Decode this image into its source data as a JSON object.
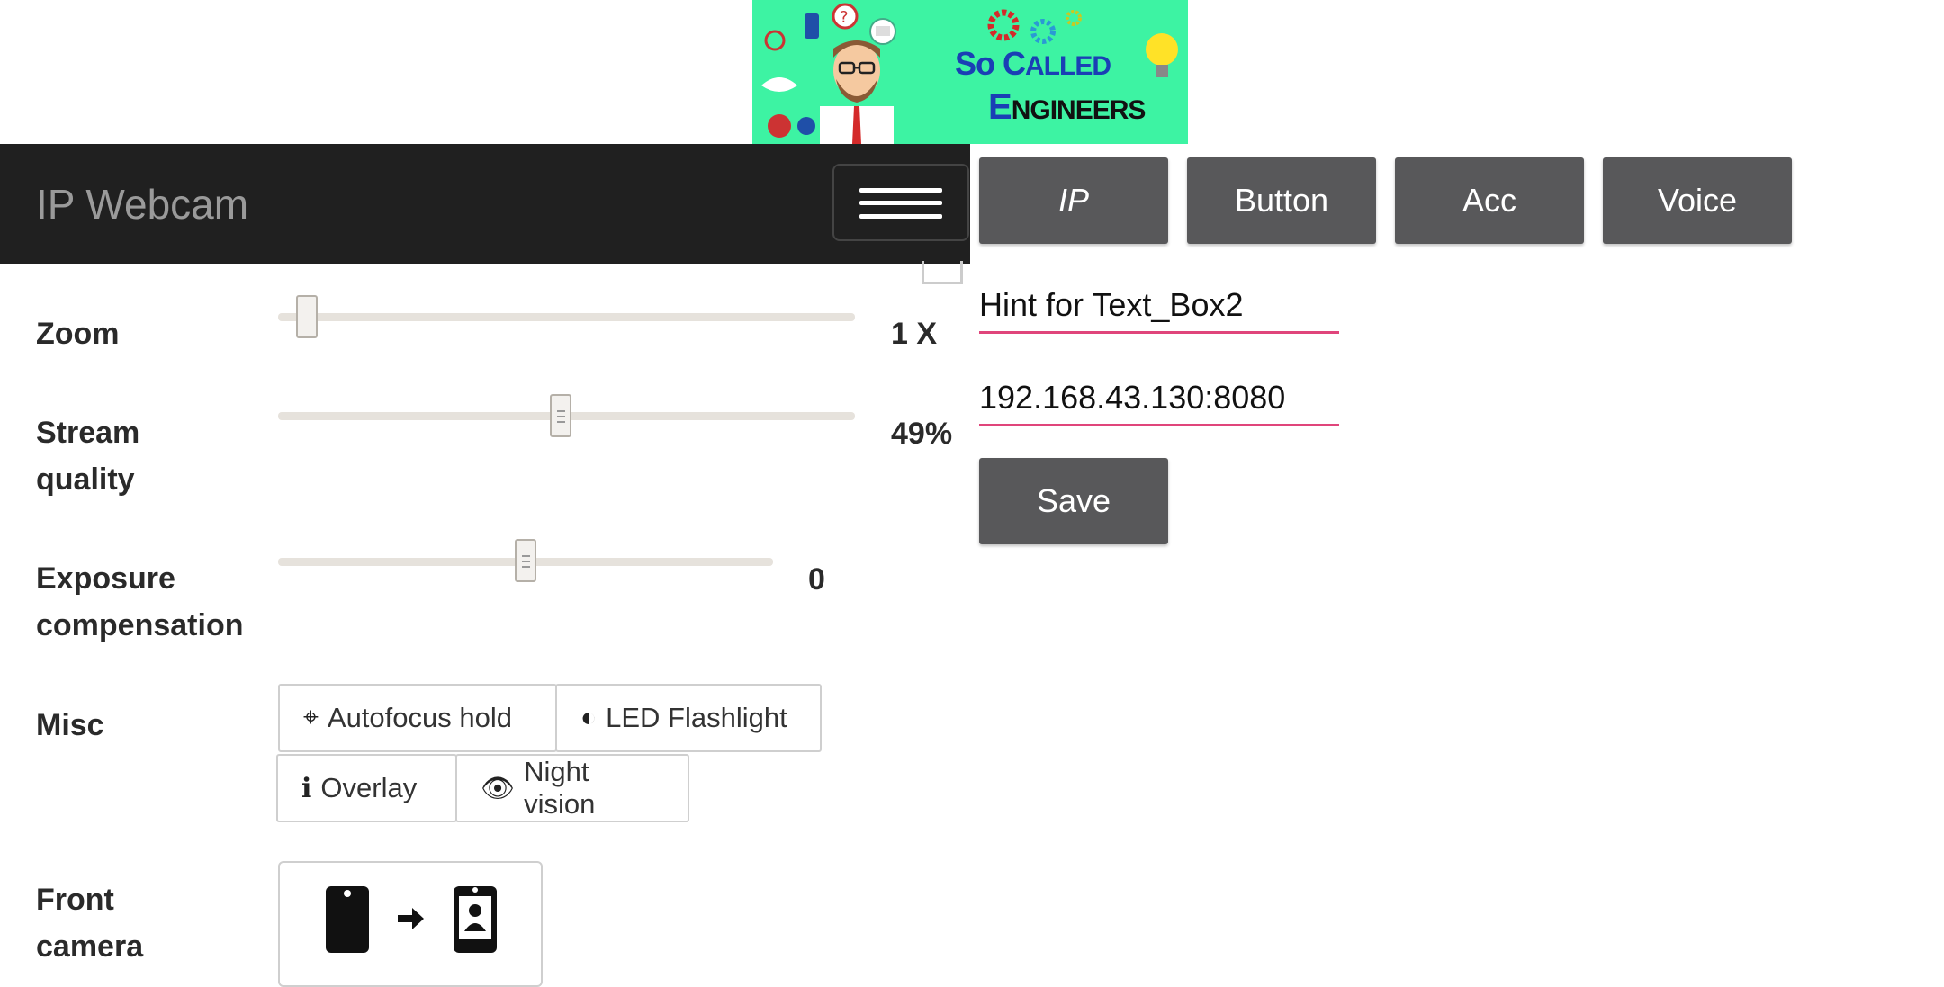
{
  "banner": {
    "line1_a": "S",
    "line1_b": "o ",
    "line1_c": "C",
    "line1_d": "alled",
    "line2_a": "E",
    "line2_b": "ngineers"
  },
  "header": {
    "title": "IP Webcam"
  },
  "controls": {
    "zoom": {
      "label": "Zoom",
      "value": "1 X",
      "level": 0.05
    },
    "stream_quality": {
      "label_line1": "Stream",
      "label_line2": "quality",
      "value": "49%",
      "level": 0.49
    },
    "exposure": {
      "label_line1": "Exposure",
      "label_line2": "compensation",
      "value": "0",
      "level": 0.5
    },
    "misc": {
      "label": "Misc",
      "buttons": [
        "Autofocus hold",
        "LED Flashlight",
        "Overlay",
        "Night vision"
      ],
      "icons": [
        "crosshair-icon",
        "half-circle-icon",
        "info-icon",
        "eye-icon"
      ]
    },
    "front_camera": {
      "label_line1": "Front",
      "label_line2": "camera"
    }
  },
  "right_panel": {
    "tabs": [
      "IP",
      "Button",
      "Acc",
      "Voice"
    ],
    "textbox2": "Hint for Text_Box2",
    "ip_field": "192.168.43.130:8080",
    "save_label": "Save"
  },
  "colors": {
    "header_bg": "#202020",
    "button_bg": "#58585a",
    "field_underline": "#e0457b",
    "banner_bg": "#3df3a3"
  }
}
